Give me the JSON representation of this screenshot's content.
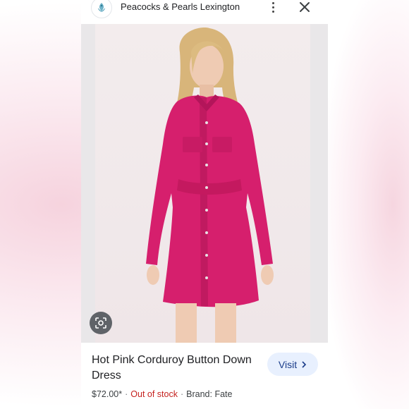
{
  "header": {
    "site_name": "Peacocks & Pearls Lexington",
    "logo_icon": "peacock-logo-icon",
    "more_icon": "more-vert-icon",
    "close_icon": "close-icon"
  },
  "image": {
    "lens_icon": "google-lens-icon",
    "subject": "model in hot pink corduroy button down dress"
  },
  "product": {
    "title": "Hot Pink Corduroy Button Down Dress",
    "price": "$72.00*",
    "separator": "·",
    "stock": "Out of stock",
    "brand": "Brand: Fate"
  },
  "actions": {
    "visit_label": "Visit",
    "visit_icon": "chevron-right-icon"
  },
  "colors": {
    "dress": "#d61f6d",
    "out_of_stock": "#c5221f",
    "visit_bg": "#e8f0fe",
    "visit_text": "#1a3c8a"
  }
}
